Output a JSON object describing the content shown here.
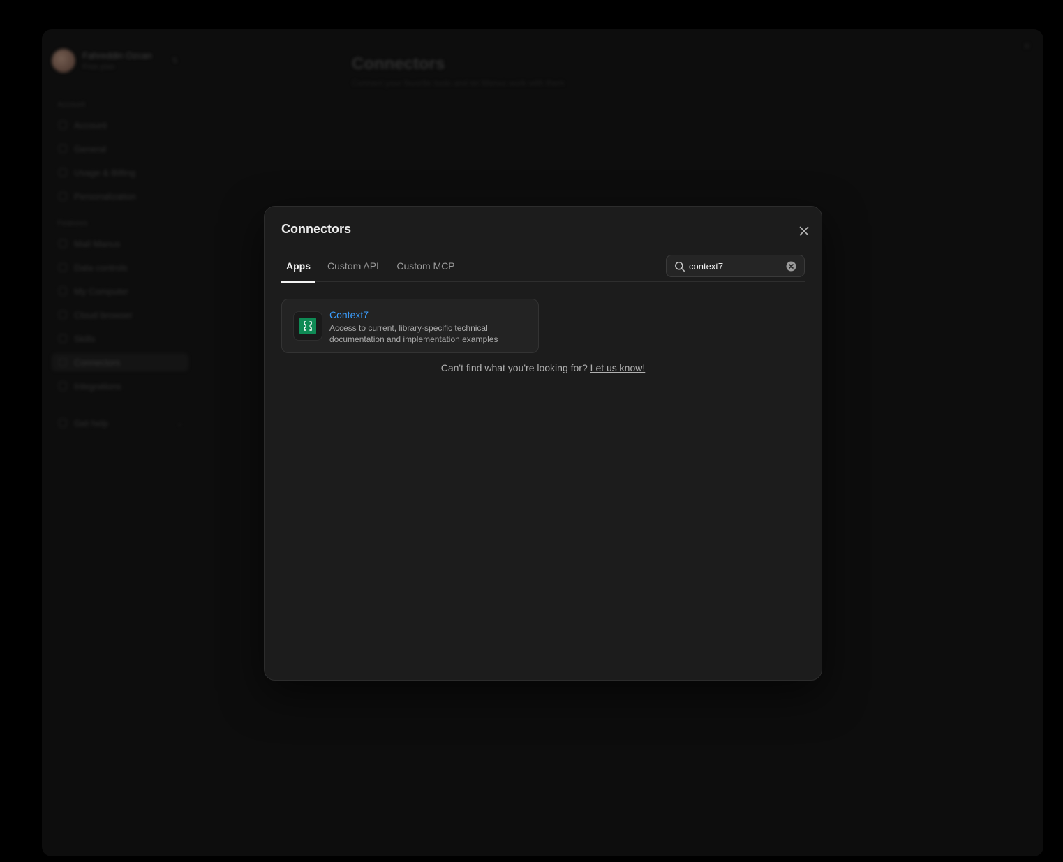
{
  "background": {
    "profile": {
      "name": "Fahreddin Ozcan",
      "plan": "Free plan"
    },
    "sections": {
      "account": "Account",
      "features": "Features"
    },
    "nav_items": [
      {
        "label": "Account"
      },
      {
        "label": "General"
      },
      {
        "label": "Usage & Billing"
      },
      {
        "label": "Personalization"
      },
      {
        "label": "Mail Manus"
      },
      {
        "label": "Data controls"
      },
      {
        "label": "My Computer"
      },
      {
        "label": "Cloud browser"
      },
      {
        "label": "Skills"
      },
      {
        "label": "Connectors"
      },
      {
        "label": "Integrations"
      },
      {
        "label": "Get help"
      }
    ],
    "page_title": "Connectors",
    "page_subtitle": "Connect your favorite tools and let Manus work with them"
  },
  "modal": {
    "title": "Connectors",
    "tabs": [
      {
        "label": "Apps",
        "active": true
      },
      {
        "label": "Custom API",
        "active": false
      },
      {
        "label": "Custom MCP",
        "active": false
      }
    ],
    "search": {
      "value": "context7",
      "placeholder": "Search"
    },
    "results": [
      {
        "name": "Context7",
        "description": "Access to current, library-specific technical documentation and implementation examples",
        "icon": "context7-logo-icon",
        "logo_color": "#0f8a55"
      }
    ],
    "help_text": "Can't find what you're looking for?",
    "help_link": "Let us know!"
  },
  "colors": {
    "link_blue": "#3b9eff",
    "modal_bg": "#1c1c1c",
    "page_bg": "#000000"
  }
}
